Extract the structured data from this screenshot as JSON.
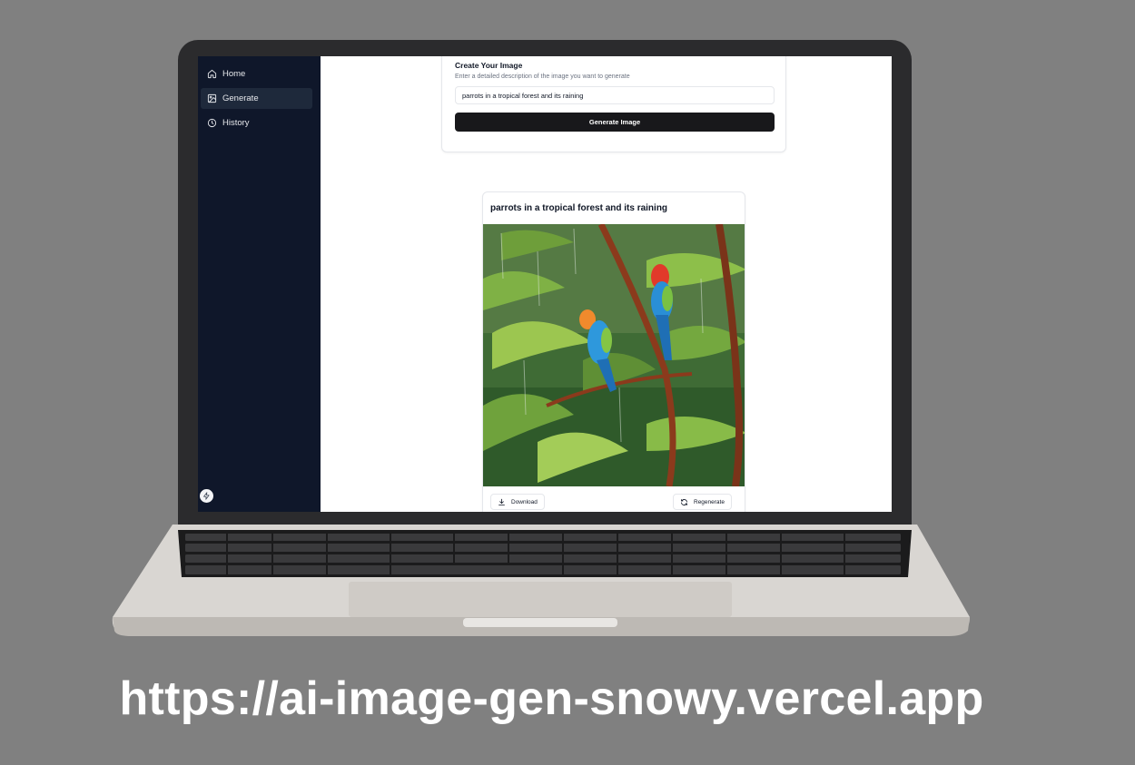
{
  "sidebar": {
    "items": [
      {
        "label": "Home",
        "icon": "home-icon"
      },
      {
        "label": "Generate",
        "icon": "image-icon",
        "active": true
      },
      {
        "label": "History",
        "icon": "clock-icon"
      }
    ],
    "bottom_icon": "theme-toggle-icon"
  },
  "create": {
    "title": "Create Your Image",
    "subtitle": "Enter a detailed description of the image you want to generate",
    "prompt_value": "parrots in a tropical forest and its raining",
    "button_label": "Generate Image"
  },
  "result": {
    "title": "parrots in a tropical forest and its raining",
    "download_label": "Download",
    "regenerate_label": "Regenerate"
  },
  "footer": {
    "url": "https://ai-image-gen-snowy.vercel.app"
  },
  "colors": {
    "background": "#808080",
    "sidebar": "#0f172a",
    "sidebar_active": "#1e293b",
    "primary_button": "#18181b"
  }
}
